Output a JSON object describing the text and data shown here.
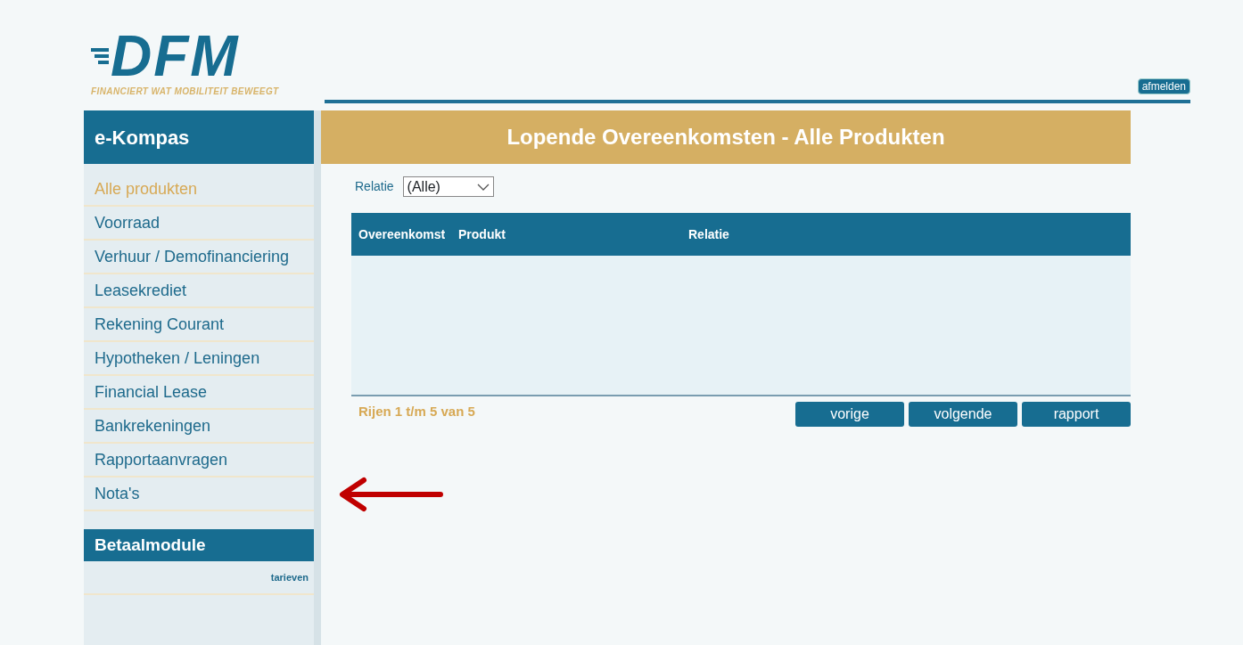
{
  "logo": {
    "text": "DFM",
    "tagline": "FINANCIERT WAT MOBILITEIT BEWEEGT"
  },
  "logout_button": "afmelden",
  "sidebar": {
    "title": "e-Kompas",
    "items": [
      {
        "label": "Alle produkten",
        "selected": true
      },
      {
        "label": "Voorraad",
        "selected": false
      },
      {
        "label": "Verhuur / Demofinanciering",
        "selected": false
      },
      {
        "label": "Leasekrediet",
        "selected": false
      },
      {
        "label": "Rekening Courant",
        "selected": false
      },
      {
        "label": "Hypotheken / Leningen",
        "selected": false
      },
      {
        "label": "Financial Lease",
        "selected": false
      },
      {
        "label": "Bankrekeningen",
        "selected": false
      },
      {
        "label": "Rapportaanvragen",
        "selected": false
      },
      {
        "label": "Nota's",
        "selected": false
      }
    ],
    "section": {
      "title": "Betaalmodule",
      "link": "tarieven"
    }
  },
  "main": {
    "title": "Lopende Overeenkomsten - Alle Produkten",
    "filter": {
      "label": "Relatie",
      "value": "(Alle)"
    },
    "table": {
      "columns": [
        "Overeenkomst",
        "Produkt",
        "Relatie"
      ]
    },
    "row_count": "Rijen 1 t/m 5 van 5",
    "buttons": [
      "vorige",
      "volgende",
      "rapport"
    ]
  }
}
